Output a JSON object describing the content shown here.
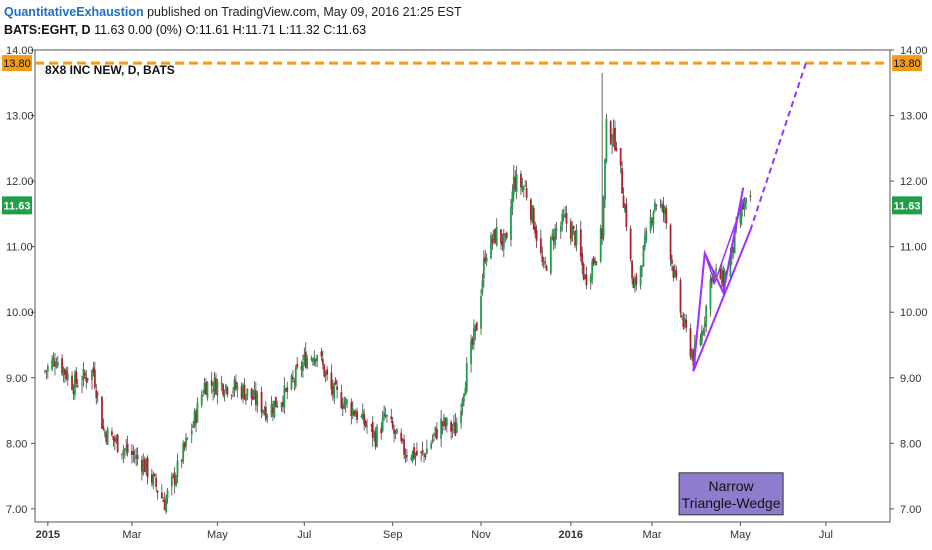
{
  "header": {
    "publisher": "QuantitativeExhaustion",
    "published_text": "published on TradingView.com, May 09, 2016 21:25 EST",
    "symbol": "BATS:EGHT, D",
    "quote": "11.63 0.00 (0%)",
    "o_label": "O:",
    "o": "11.61",
    "h_label": "H:",
    "h": "11.71",
    "l_label": "L:",
    "l": "11.32",
    "c_label": "C:",
    "c": "11.63"
  },
  "colors": {
    "up": "#1f9e48",
    "down": "#b0202a",
    "wick": "#444444",
    "resistance": "#f59c16",
    "pattern": "#9b30ff",
    "last_price_badge": "#1f9e48",
    "note_bg": "#8f7ccc",
    "axis_text": "#333333"
  },
  "chart_data": {
    "type": "candlestick",
    "title": "8X8 INC NEW, D, BATS",
    "ylim": [
      6.8,
      14.0
    ],
    "yticks": [
      "14.00",
      "13.00",
      "12.00",
      "11.00",
      "10.00",
      "9.00",
      "8.00",
      "7.00"
    ],
    "xticks": [
      {
        "label": "2015",
        "bold": true,
        "date": "2015-01-02"
      },
      {
        "label": "Mar",
        "bold": false,
        "date": "2015-03-02"
      },
      {
        "label": "May",
        "bold": false,
        "date": "2015-05-01"
      },
      {
        "label": "Jul",
        "bold": false,
        "date": "2015-07-01"
      },
      {
        "label": "Sep",
        "bold": false,
        "date": "2015-09-01"
      },
      {
        "label": "Nov",
        "bold": false,
        "date": "2015-11-02"
      },
      {
        "label": "2016",
        "bold": true,
        "date": "2016-01-04"
      },
      {
        "label": "Mar",
        "bold": false,
        "date": "2016-03-01"
      },
      {
        "label": "May",
        "bold": false,
        "date": "2016-05-02"
      },
      {
        "label": "Jul",
        "bold": false,
        "date": "2016-07-01"
      }
    ],
    "xrange": [
      "2014-12-24",
      "2016-08-15"
    ],
    "price_path": [
      {
        "date": "2014-12-31",
        "close": 9.1
      },
      {
        "date": "2015-01-08",
        "close": 9.3
      },
      {
        "date": "2015-01-20",
        "close": 8.9
      },
      {
        "date": "2015-02-03",
        "close": 9.1
      },
      {
        "date": "2015-02-10",
        "close": 8.2
      },
      {
        "date": "2015-02-25",
        "close": 7.9
      },
      {
        "date": "2015-03-10",
        "close": 7.7
      },
      {
        "date": "2015-03-25",
        "close": 7.1
      },
      {
        "date": "2015-04-03",
        "close": 7.6
      },
      {
        "date": "2015-04-14",
        "close": 8.3
      },
      {
        "date": "2015-04-22",
        "close": 8.9
      },
      {
        "date": "2015-05-05",
        "close": 8.9
      },
      {
        "date": "2015-05-20",
        "close": 8.8
      },
      {
        "date": "2015-06-05",
        "close": 8.5
      },
      {
        "date": "2015-06-20",
        "close": 8.8
      },
      {
        "date": "2015-07-02",
        "close": 9.3
      },
      {
        "date": "2015-07-10",
        "close": 9.4
      },
      {
        "date": "2015-07-20",
        "close": 8.8
      },
      {
        "date": "2015-08-05",
        "close": 8.5
      },
      {
        "date": "2015-08-20",
        "close": 8.1
      },
      {
        "date": "2015-08-27",
        "close": 8.4
      },
      {
        "date": "2015-09-08",
        "close": 7.9
      },
      {
        "date": "2015-09-22",
        "close": 7.8
      },
      {
        "date": "2015-10-05",
        "close": 8.3
      },
      {
        "date": "2015-10-15",
        "close": 8.2
      },
      {
        "date": "2015-10-22",
        "close": 9.0
      },
      {
        "date": "2015-10-30",
        "close": 9.8
      },
      {
        "date": "2015-11-05",
        "close": 10.9
      },
      {
        "date": "2015-11-13",
        "close": 11.2
      },
      {
        "date": "2015-11-20",
        "close": 11.0
      },
      {
        "date": "2015-11-25",
        "close": 12.0
      },
      {
        "date": "2015-12-03",
        "close": 11.9
      },
      {
        "date": "2015-12-10",
        "close": 11.3
      },
      {
        "date": "2015-12-16",
        "close": 10.6
      },
      {
        "date": "2015-12-23",
        "close": 11.2
      },
      {
        "date": "2015-12-31",
        "close": 11.4
      },
      {
        "date": "2016-01-08",
        "close": 11.1
      },
      {
        "date": "2016-01-14",
        "close": 10.5
      },
      {
        "date": "2016-01-20",
        "close": 10.8
      },
      {
        "date": "2016-01-26",
        "close": 11.2
      },
      {
        "date": "2016-01-29",
        "close": 12.8
      },
      {
        "date": "2016-02-05",
        "close": 12.6
      },
      {
        "date": "2016-02-12",
        "close": 11.4
      },
      {
        "date": "2016-02-17",
        "close": 10.3
      },
      {
        "date": "2016-02-24",
        "close": 10.9
      },
      {
        "date": "2016-03-03",
        "close": 11.7
      },
      {
        "date": "2016-03-10",
        "close": 11.5
      },
      {
        "date": "2016-03-17",
        "close": 10.5
      },
      {
        "date": "2016-03-22",
        "close": 9.9
      },
      {
        "date": "2016-03-30",
        "close": 9.3
      },
      {
        "date": "2016-04-05",
        "close": 9.7
      },
      {
        "date": "2016-04-12",
        "close": 10.6
      },
      {
        "date": "2016-04-20",
        "close": 10.5
      },
      {
        "date": "2016-04-26",
        "close": 10.9
      },
      {
        "date": "2016-05-03",
        "close": 11.6
      },
      {
        "date": "2016-05-09",
        "close": 11.63
      }
    ],
    "price_range_per_bar": 0.32,
    "wicks": [
      {
        "date": "2016-01-26",
        "high": 13.65
      },
      {
        "date": "2015-11-25",
        "high": 12.25
      },
      {
        "date": "2015-03-25",
        "low": 6.98
      }
    ],
    "resistance": {
      "price": 13.8,
      "label": "13.80"
    },
    "last_price": {
      "price": 11.63,
      "label": "11.63"
    },
    "wedge": {
      "upper": [
        [
          "2016-03-30",
          9.1
        ],
        [
          "2016-04-07",
          10.9
        ],
        [
          "2016-04-20",
          10.3
        ],
        [
          "2016-05-04",
          11.9
        ]
      ],
      "lower_line": [
        [
          "2016-03-30",
          9.1
        ],
        [
          "2016-05-09",
          11.25
        ]
      ],
      "inner": [
        [
          "2016-04-07",
          10.9
        ],
        [
          "2016-04-14",
          10.45
        ],
        [
          "2016-05-05",
          11.75
        ]
      ],
      "projection": [
        [
          "2016-05-09",
          11.25
        ],
        [
          "2016-06-17",
          13.8
        ]
      ]
    },
    "annotation": {
      "line1": "Narrow",
      "line2": "Triangle-Wedge"
    }
  }
}
